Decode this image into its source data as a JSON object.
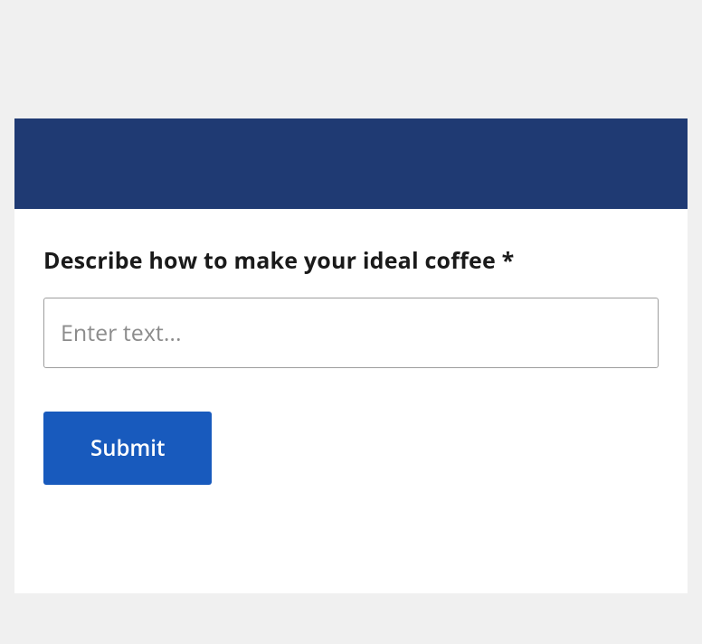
{
  "form": {
    "question_label": "Describe how to make your ideal coffee *",
    "input_placeholder": "Enter text...",
    "input_value": "",
    "submit_label": "Submit"
  }
}
